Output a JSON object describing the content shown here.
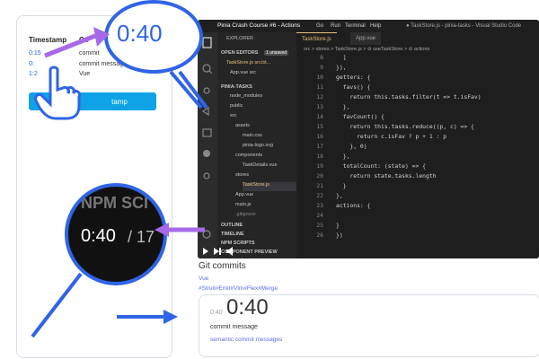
{
  "left_panel": {
    "headers": [
      "Timestamp",
      "Co"
    ],
    "rows": [
      {
        "time": "0:15",
        "text": "commit"
      },
      {
        "time": "0:",
        "text": "commit message"
      },
      {
        "time": "1:2",
        "text": "Vue"
      }
    ],
    "button_label": "tamp"
  },
  "vscode": {
    "title": "Pinia Crash Course #6 - Actions",
    "menu": [
      "Go",
      "Run",
      "Terminal",
      "Help"
    ],
    "window_title": "● TaskStore.js - pinia-tasks - Visual Studio Code",
    "tabs": [
      {
        "label": "TaskStore.js",
        "active": true
      },
      {
        "label": "App.vue",
        "active": false
      }
    ],
    "breadcrumb": "src > stores > TaskStore.js > ⊘ useTaskStore > ⊘ actions",
    "sidebar": {
      "explorer_label": "EXPLORER",
      "open_editors_label": "OPEN EDITORS",
      "unsaved_badge": "1 unsaved",
      "open_files": [
        "TaskStore.js src/st...",
        "App.vue src"
      ],
      "project_label": "PINIA-TASKS",
      "tree": [
        "node_modules",
        "public",
        "src",
        "assets",
        "main.css",
        "pinia-logo.svg",
        "components",
        "TaskDetails.vue",
        "stores",
        "TaskStore.js",
        "App.vue",
        "main.js",
        ".gitignore"
      ],
      "outline_label": "OUTLINE",
      "timeline_label": "TIMELINE",
      "npm_label": "NPM SCRIPTS",
      "preview_label": "COMPONENT PREVIEW"
    },
    "code_lines": [
      {
        "num": "8",
        "text": "  ]"
      },
      {
        "num": "9",
        "text": "}),"
      },
      {
        "num": "10",
        "text": "getters: {"
      },
      {
        "num": "11",
        "text": "  favs() {"
      },
      {
        "num": "12",
        "text": "    return this.tasks.filter(t => t.isFav)"
      },
      {
        "num": "13",
        "text": "  },"
      },
      {
        "num": "14",
        "text": "  favCount() {"
      },
      {
        "num": "15",
        "text": "    return this.tasks.reduce((p, c) => {"
      },
      {
        "num": "16",
        "text": "      return c.isFav ? p + 1 : p"
      },
      {
        "num": "17",
        "text": "    }, 0)"
      },
      {
        "num": "18",
        "text": "  },"
      },
      {
        "num": "19",
        "text": "  totalCount: (state) => {"
      },
      {
        "num": "20",
        "text": "    return state.tasks.length"
      },
      {
        "num": "21",
        "text": "  }"
      },
      {
        "num": "22",
        "text": "},"
      },
      {
        "num": "23",
        "text": "actions: {"
      },
      {
        "num": "24",
        "text": ""
      },
      {
        "num": "25",
        "text": "}"
      },
      {
        "num": "26",
        "text": "})"
      }
    ],
    "video_controls": {
      "timestamp": "0:40"
    }
  },
  "magnifier_top": {
    "time": "0:40"
  },
  "magnifier_mid": {
    "time": "0:40",
    "extra": "/ 17",
    "bg_text": "NPM SCI"
  },
  "git": {
    "title": "Git commits",
    "subtitle": "Vue",
    "tags": "#Struit#Emit#Vlm#Flex#Merge",
    "card": {
      "small_time": "0:40",
      "big_time": "0:40",
      "message": "commit message",
      "footer": "semantic commit messages"
    }
  },
  "colors": {
    "accent_blue": "#2f64e6",
    "arrow_purple": "#a869e8",
    "button_blue": "#0ea3e6",
    "vscode_bg": "#1e1e1e"
  }
}
